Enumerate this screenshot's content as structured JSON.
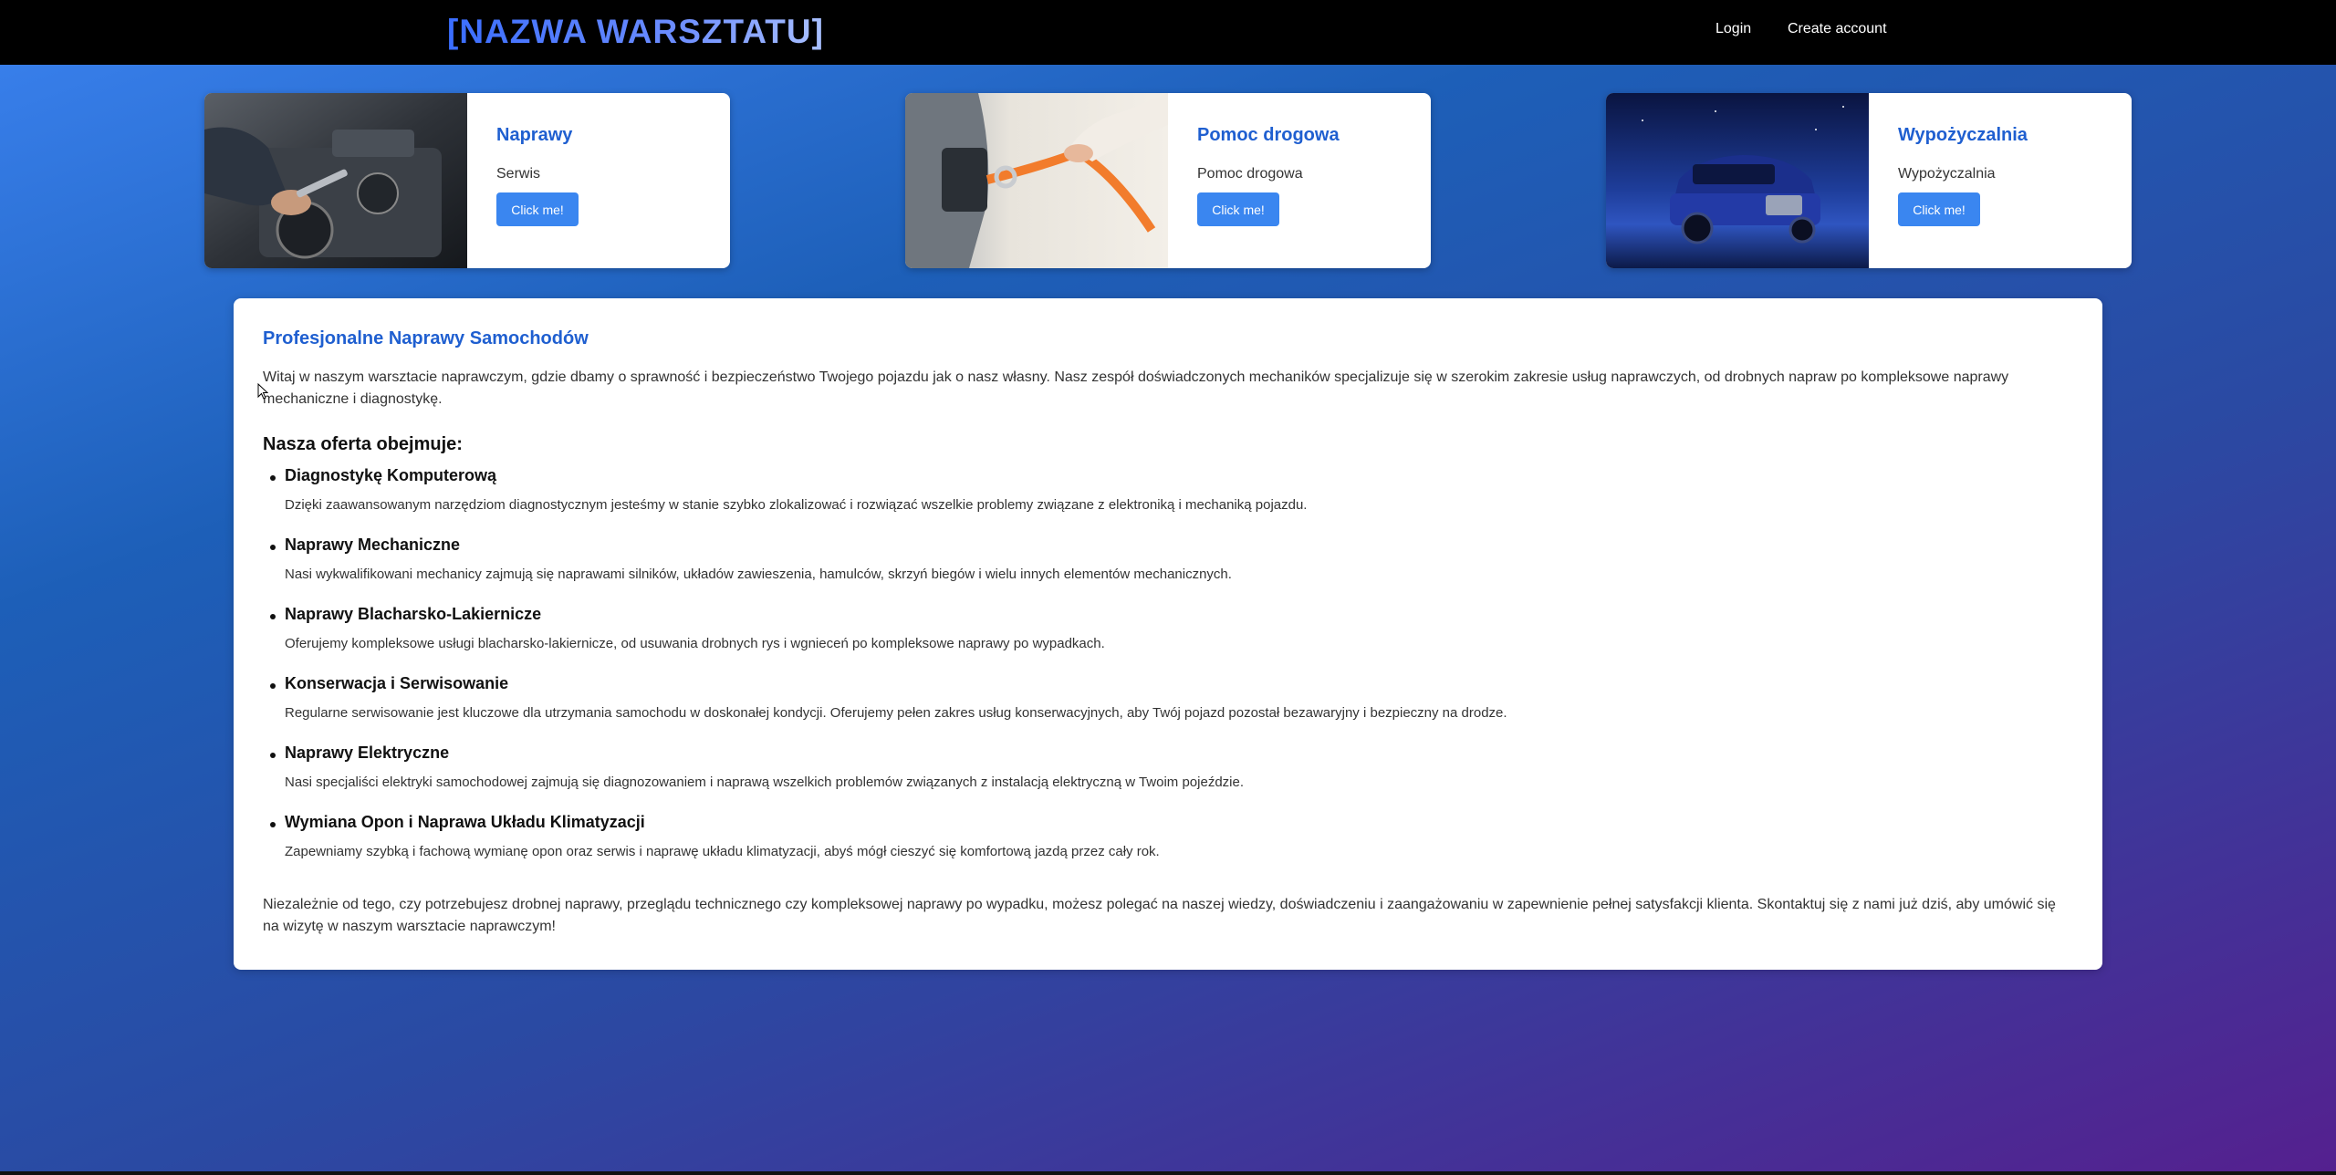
{
  "header": {
    "brand": "[NAZWA WARSZTATU]",
    "login": "Login",
    "create_account": "Create account"
  },
  "cards": [
    {
      "title": "Naprawy",
      "text": "Serwis",
      "button": "Click me!",
      "image": "engine-repair-photo"
    },
    {
      "title": "Pomoc drogowa",
      "text": "Pomoc drogowa",
      "button": "Click me!",
      "image": "tow-strap-photo"
    },
    {
      "title": "Wypożyczalnia",
      "text": "Wypożyczalnia",
      "button": "Click me!",
      "image": "blue-suv-photo"
    }
  ],
  "content": {
    "title": "Profesjonalne Naprawy Samochodów",
    "intro": "Witaj w naszym warsztacie naprawczym, gdzie dbamy o sprawność i bezpieczeństwo Twojego pojazdu jak o nasz własny. Nasz zespół doświadczonych mechaników specjalizuje się w szerokim zakresie usług naprawczych, od drobnych napraw po kompleksowe naprawy mechaniczne i diagnostykę.",
    "offer_heading": "Nasza oferta obejmuje:",
    "offers": [
      {
        "name": "Diagnostykę Komputerową",
        "desc": "Dzięki zaawansowanym narzędziom diagnostycznym jesteśmy w stanie szybko zlokalizować i rozwiązać wszelkie problemy związane z elektroniką i mechaniką pojazdu."
      },
      {
        "name": "Naprawy Mechaniczne",
        "desc": "Nasi wykwalifikowani mechanicy zajmują się naprawami silników, układów zawieszenia, hamulców, skrzyń biegów i wielu innych elementów mechanicznych."
      },
      {
        "name": "Naprawy Blacharsko-Lakiernicze",
        "desc": "Oferujemy kompleksowe usługi blacharsko-lakiernicze, od usuwania drobnych rys i wgnieceń po kompleksowe naprawy po wypadkach."
      },
      {
        "name": "Konserwacja i Serwisowanie",
        "desc": "Regularne serwisowanie jest kluczowe dla utrzymania samochodu w doskonałej kondycji. Oferujemy pełen zakres usług konserwacyjnych, aby Twój pojazd pozostał bezawaryjny i bezpieczny na drodze."
      },
      {
        "name": "Naprawy Elektryczne",
        "desc": "Nasi specjaliści elektryki samochodowej zajmują się diagnozowaniem i naprawą wszelkich problemów związanych z instalacją elektryczną w Twoim pojeździe."
      },
      {
        "name": "Wymiana Opon i Naprawa Układu Klimatyzacji",
        "desc": "Zapewniamy szybką i fachową wymianę opon oraz serwis i naprawę układu klimatyzacji, abyś mógł cieszyć się komfortową jazdą przez cały rok."
      }
    ],
    "outro": "Niezależnie od tego, czy potrzebujesz drobnej naprawy, przeglądu technicznego czy kompleksowej naprawy po wypadku, możesz polegać na naszej wiedzy, doświadczeniu i zaangażowaniu w zapewnienie pełnej satysfakcji klienta. Skontaktuj się z nami już dziś, aby umówić się na wizytę w naszym warsztacie naprawczym!"
  },
  "colors": {
    "accent": "#1f5fd0",
    "button": "#3a86f0",
    "header_bg": "#000000"
  }
}
